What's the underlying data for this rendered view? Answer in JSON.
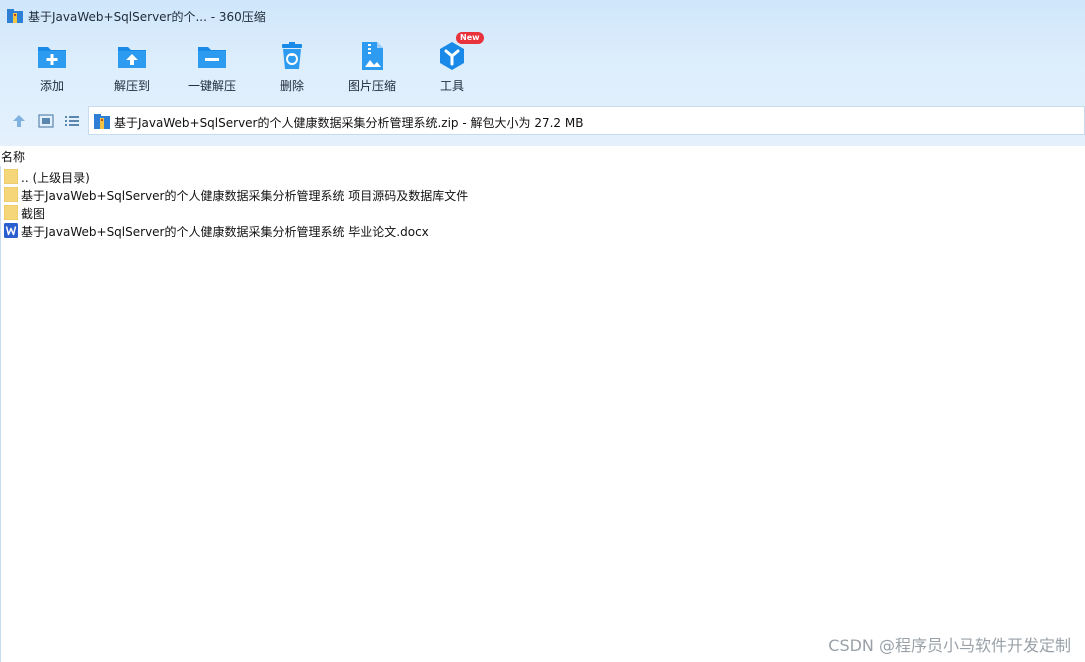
{
  "window": {
    "title": "基于JavaWeb+SqlServer的个... - 360压缩",
    "app_icon": "archive-icon"
  },
  "toolbar": {
    "items": [
      {
        "label": "添加",
        "icon": "add-folder-icon"
      },
      {
        "label": "解压到",
        "icon": "extract-to-icon"
      },
      {
        "label": "一键解压",
        "icon": "one-click-extract-icon"
      },
      {
        "label": "删除",
        "icon": "trash-icon"
      },
      {
        "label": "图片压缩",
        "icon": "image-compress-icon"
      },
      {
        "label": "工具",
        "icon": "tools-icon",
        "badge": "New"
      }
    ]
  },
  "nav": {
    "up_icon": "arrow-up-icon",
    "view_thumb_icon": "thumbnail-view-icon",
    "view_list_icon": "list-view-icon",
    "address": "基于JavaWeb+SqlServer的个人健康数据采集分析管理系统.zip - 解包大小为 27.2 MB"
  },
  "list": {
    "column_name": "名称",
    "rows": [
      {
        "name": ".. (上级目录)",
        "icon": "folder-icon"
      },
      {
        "name": "基于JavaWeb+SqlServer的个人健康数据采集分析管理系统 项目源码及数据库文件",
        "icon": "folder-icon"
      },
      {
        "name": "截图",
        "icon": "folder-icon"
      },
      {
        "name": "基于JavaWeb+SqlServer的个人健康数据采集分析管理系统 毕业论文.docx",
        "icon": "word-doc-icon"
      }
    ]
  },
  "watermark": "CSDN @程序员小马软件开发定制",
  "colors": {
    "accent": "#1a8ae8",
    "folder": "#f5d77a",
    "word": "#2b5fcf",
    "badge": "#e8323c"
  }
}
